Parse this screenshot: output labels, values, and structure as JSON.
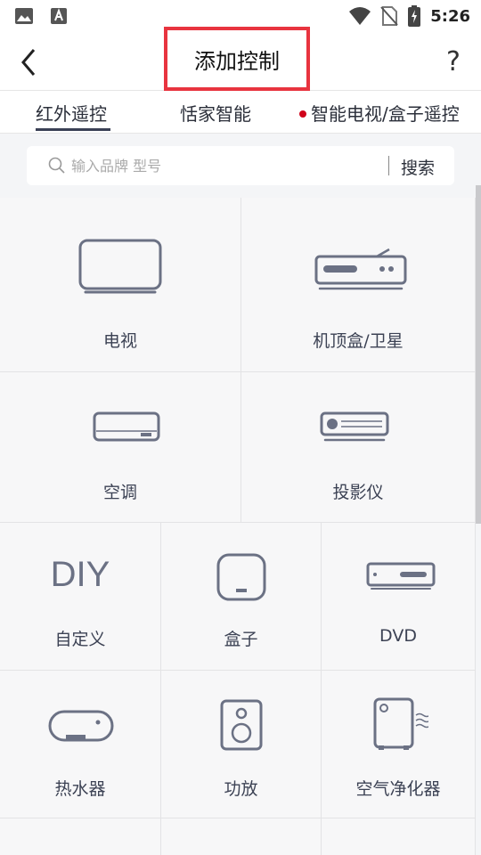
{
  "status": {
    "time": "5:26"
  },
  "header": {
    "title": "添加控制",
    "help": "?"
  },
  "tabs": [
    {
      "label": "红外遥控"
    },
    {
      "label": "恬家智能"
    },
    {
      "label": "智能电视/盒子遥控"
    }
  ],
  "search": {
    "placeholder": "输入品牌 型号",
    "button": "搜索"
  },
  "devices": [
    {
      "label": "电视",
      "icon": "tv-icon"
    },
    {
      "label": "机顶盒/卫星",
      "icon": "settop-box-icon"
    },
    {
      "label": "空调",
      "icon": "air-conditioner-icon"
    },
    {
      "label": "投影仪",
      "icon": "projector-icon"
    },
    {
      "label": "自定义",
      "icon": "diy-icon",
      "icon_text": "DIY"
    },
    {
      "label": "盒子",
      "icon": "box-icon"
    },
    {
      "label": "DVD",
      "icon": "dvd-icon"
    },
    {
      "label": "热水器",
      "icon": "water-heater-icon"
    },
    {
      "label": "功放",
      "icon": "speaker-icon"
    },
    {
      "label": "空气净化器",
      "icon": "air-purifier-icon"
    }
  ],
  "colors": {
    "accent": "#e8343f",
    "icon": "#6b7184",
    "text": "#3c4254",
    "red_dot": "#d0021b"
  }
}
